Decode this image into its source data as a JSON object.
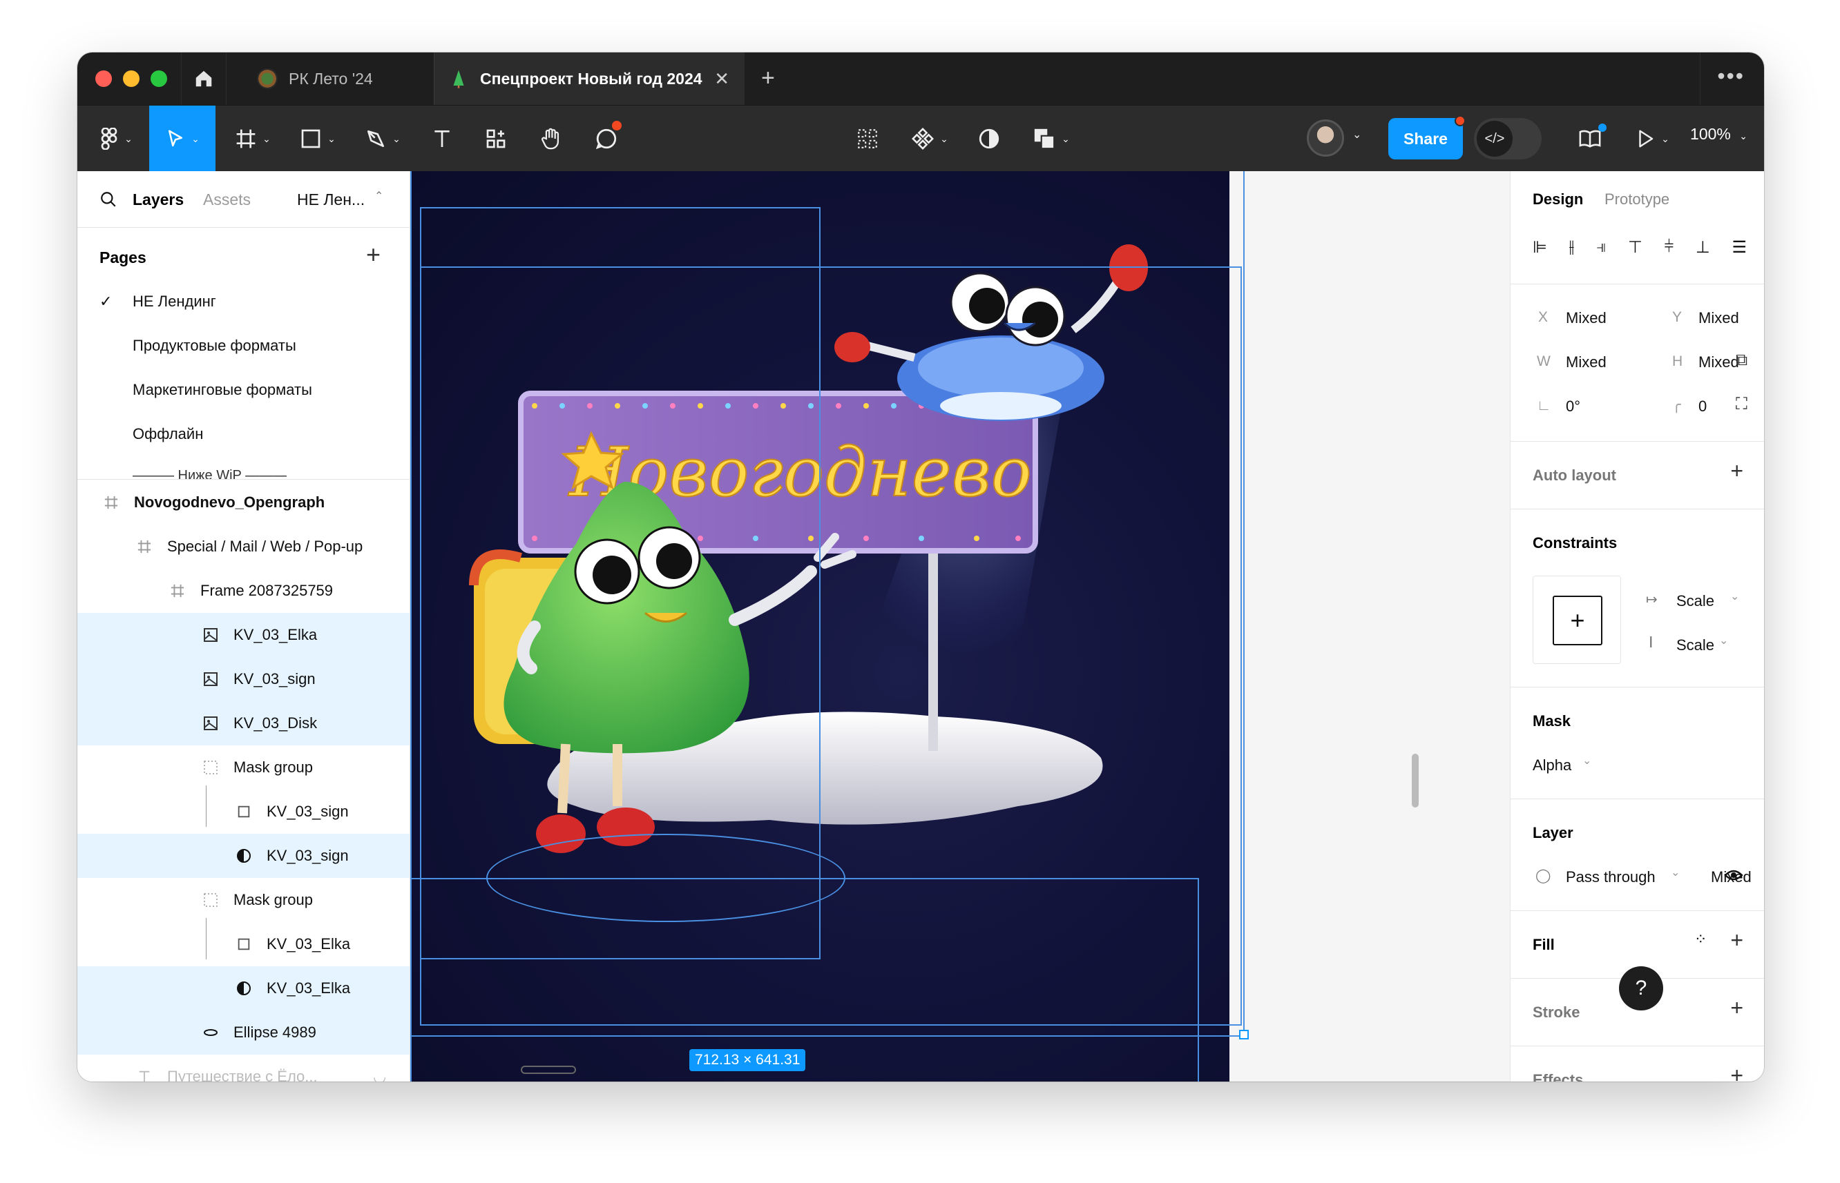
{
  "tabs": {
    "tab1_title": "РК Лето '24",
    "tab2_title": "Спецпроект Новый год 2024",
    "close_glyph": "✕",
    "add_glyph": "+",
    "more_glyph": "•••"
  },
  "toolbar": {
    "share_label": "Share",
    "zoom": "100%",
    "dev_glyph": "</>"
  },
  "left_panel": {
    "tab_layers": "Layers",
    "tab_assets": "Assets",
    "page_selector": "НЕ Лен...",
    "pages_header": "Pages",
    "pages": [
      "НЕ Лендинг",
      "Продуктовые форматы",
      "Маркетинговые форматы",
      "Оффлайн",
      "——— Ниже WiP ———"
    ],
    "layers": [
      "Novogodnevo_Opengraph",
      "Special / Mail / Web / Pop-up",
      "Frame 2087325759",
      "KV_03_Elka",
      "KV_03_sign",
      "KV_03_Disk",
      "Mask group",
      "KV_03_sign",
      "KV_03_sign",
      "Mask group",
      "KV_03_Elka",
      "KV_03_Elka",
      "Ellipse 4989",
      "Путешествие с Ёло..."
    ]
  },
  "canvas": {
    "dimensions": "712.13 × 641.31",
    "sign_text": "Новогоднево"
  },
  "right_panel": {
    "tab_design": "Design",
    "tab_prototype": "Prototype",
    "x_label": "X",
    "x_value": "Mixed",
    "y_label": "Y",
    "y_value": "Mixed",
    "w_label": "W",
    "w_value": "Mixed",
    "h_label": "H",
    "h_value": "Mixed",
    "rotation": "0°",
    "radius": "0",
    "auto_layout": "Auto layout",
    "constraints": "Constraints",
    "constraint_h": "Scale",
    "constraint_v": "Scale",
    "mask": "Mask",
    "mask_type": "Alpha",
    "layer": "Layer",
    "blend_mode": "Pass through",
    "opacity": "Mixed",
    "fill": "Fill",
    "stroke": "Stroke",
    "effects": "Effects",
    "help": "?"
  },
  "colors": {
    "accent": "#0d99ff",
    "selection": "#e5f4ff",
    "toolbar_bg": "#2c2c2c",
    "title_bg": "#1e1e1e",
    "artboard_bg": "#11133a"
  },
  "icons": [
    "home-icon",
    "figma-menu-icon",
    "move-icon",
    "frame-icon",
    "rectangle-icon",
    "pen-icon",
    "text-icon",
    "resources-icon",
    "hand-icon",
    "comment-icon",
    "grid-icon",
    "component-icon",
    "contrast-icon",
    "boolean-icon",
    "library-icon",
    "present-icon",
    "search-icon",
    "eye-icon",
    "plus-icon"
  ]
}
